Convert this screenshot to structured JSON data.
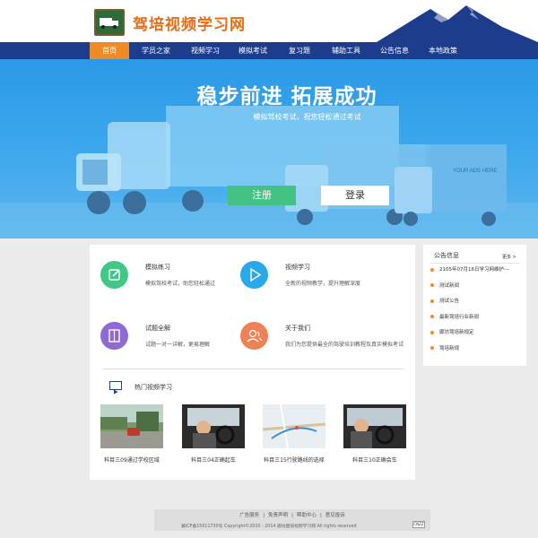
{
  "header": {
    "site_title": "驾培视频学习网"
  },
  "nav": {
    "items": [
      "首页",
      "学员之家",
      "视频学习",
      "模拟考试",
      "复习题",
      "辅助工具",
      "公告信息",
      "本地政策"
    ],
    "active_index": 0
  },
  "banner": {
    "title": "稳步前进  拓展成功",
    "subtitle": "模拟驾校考试，祝您轻松通过考试",
    "register_label": "注册",
    "login_label": "登录",
    "truck_text": "YOUR ADS HERE"
  },
  "features": [
    {
      "title": "模拟练习",
      "desc": "模拟驾校考试，助您轻松通过",
      "icon": "edit-icon",
      "color": "#3fc888"
    },
    {
      "title": "视频学习",
      "desc": "全新的视频教学，提升理解深度",
      "icon": "play-icon",
      "color": "#29a9e9"
    },
    {
      "title": "试题全解",
      "desc": "试题一对一详解，更易理解",
      "icon": "book-icon",
      "color": "#8d6bd1"
    },
    {
      "title": "关于我们",
      "desc": "我们为您提供最全的驾驶培训教程及真实模拟考试",
      "icon": "users-icon",
      "color": "#f08156"
    }
  ],
  "hot_videos": {
    "title": "热门视频学习",
    "items": [
      {
        "caption": "科目三09通过学校区域"
      },
      {
        "caption": "科目三04正确起车"
      },
      {
        "caption": "科目三15行驶路线的选择"
      },
      {
        "caption": "科目三10正确会车"
      }
    ]
  },
  "sidebar": {
    "title": "公告信息",
    "more": "更多 >",
    "items": [
      "2105年07月16日学习网维护---",
      "测试新闻",
      "测试公告",
      "最新驾培行业新闻",
      "廊坊驾培新规定",
      "驾培新规"
    ]
  },
  "footer": {
    "links": [
      "广告服务",
      "免责声明",
      "帮助中心",
      "意见投诉"
    ],
    "separator": "|",
    "copyright": "冀ICP备15011730号 Copyright©2010 - 2014 廊坊国培视频学习网 All rights reserved",
    "badge": "CNZZ"
  }
}
